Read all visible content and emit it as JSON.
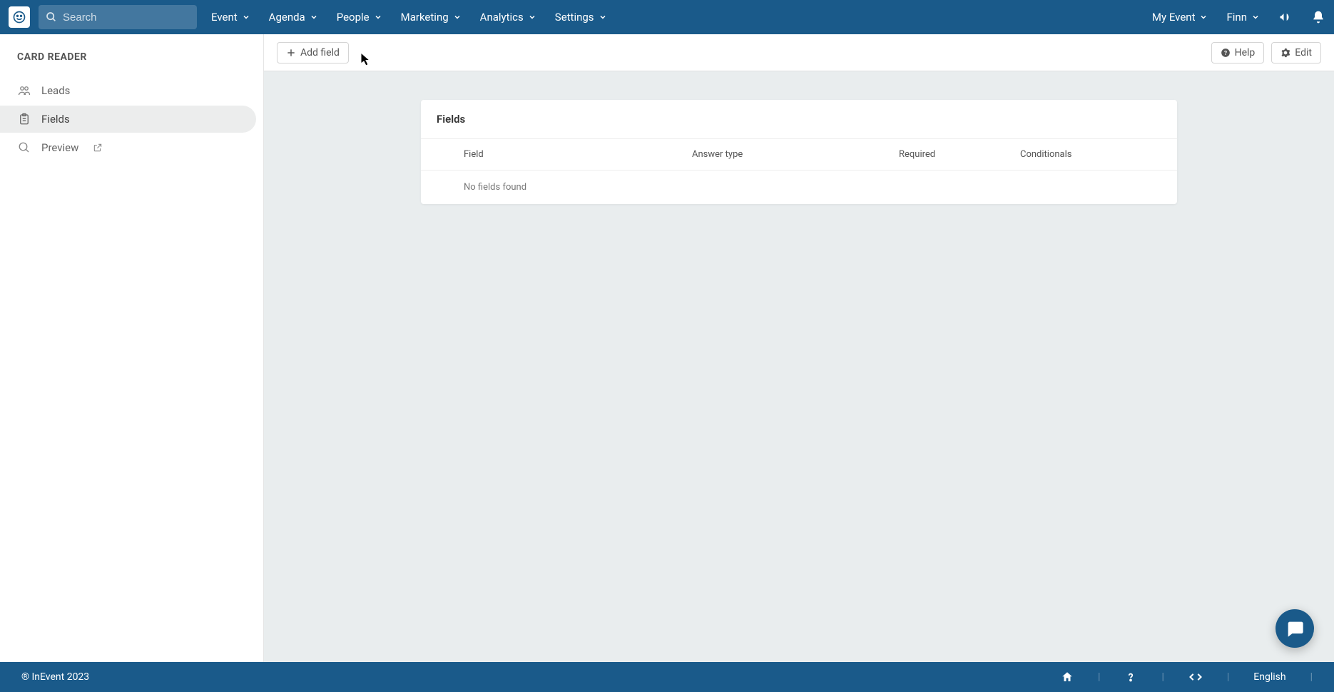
{
  "topnav": {
    "search_placeholder": "Search",
    "menu": [
      "Event",
      "Agenda",
      "People",
      "Marketing",
      "Analytics",
      "Settings"
    ],
    "right": {
      "event_label": "My Event",
      "user_label": "Finn"
    }
  },
  "sidebar": {
    "title": "CARD READER",
    "items": [
      {
        "label": "Leads"
      },
      {
        "label": "Fields"
      },
      {
        "label": "Preview"
      }
    ]
  },
  "toolbar": {
    "add_field_label": "Add field",
    "help_label": "Help",
    "edit_label": "Edit"
  },
  "panel": {
    "title": "Fields",
    "columns": {
      "field": "Field",
      "answer_type": "Answer type",
      "required": "Required",
      "conditionals": "Conditionals"
    },
    "empty_text": "No fields found"
  },
  "footer": {
    "copyright": "® InEvent 2023",
    "language": "English"
  }
}
